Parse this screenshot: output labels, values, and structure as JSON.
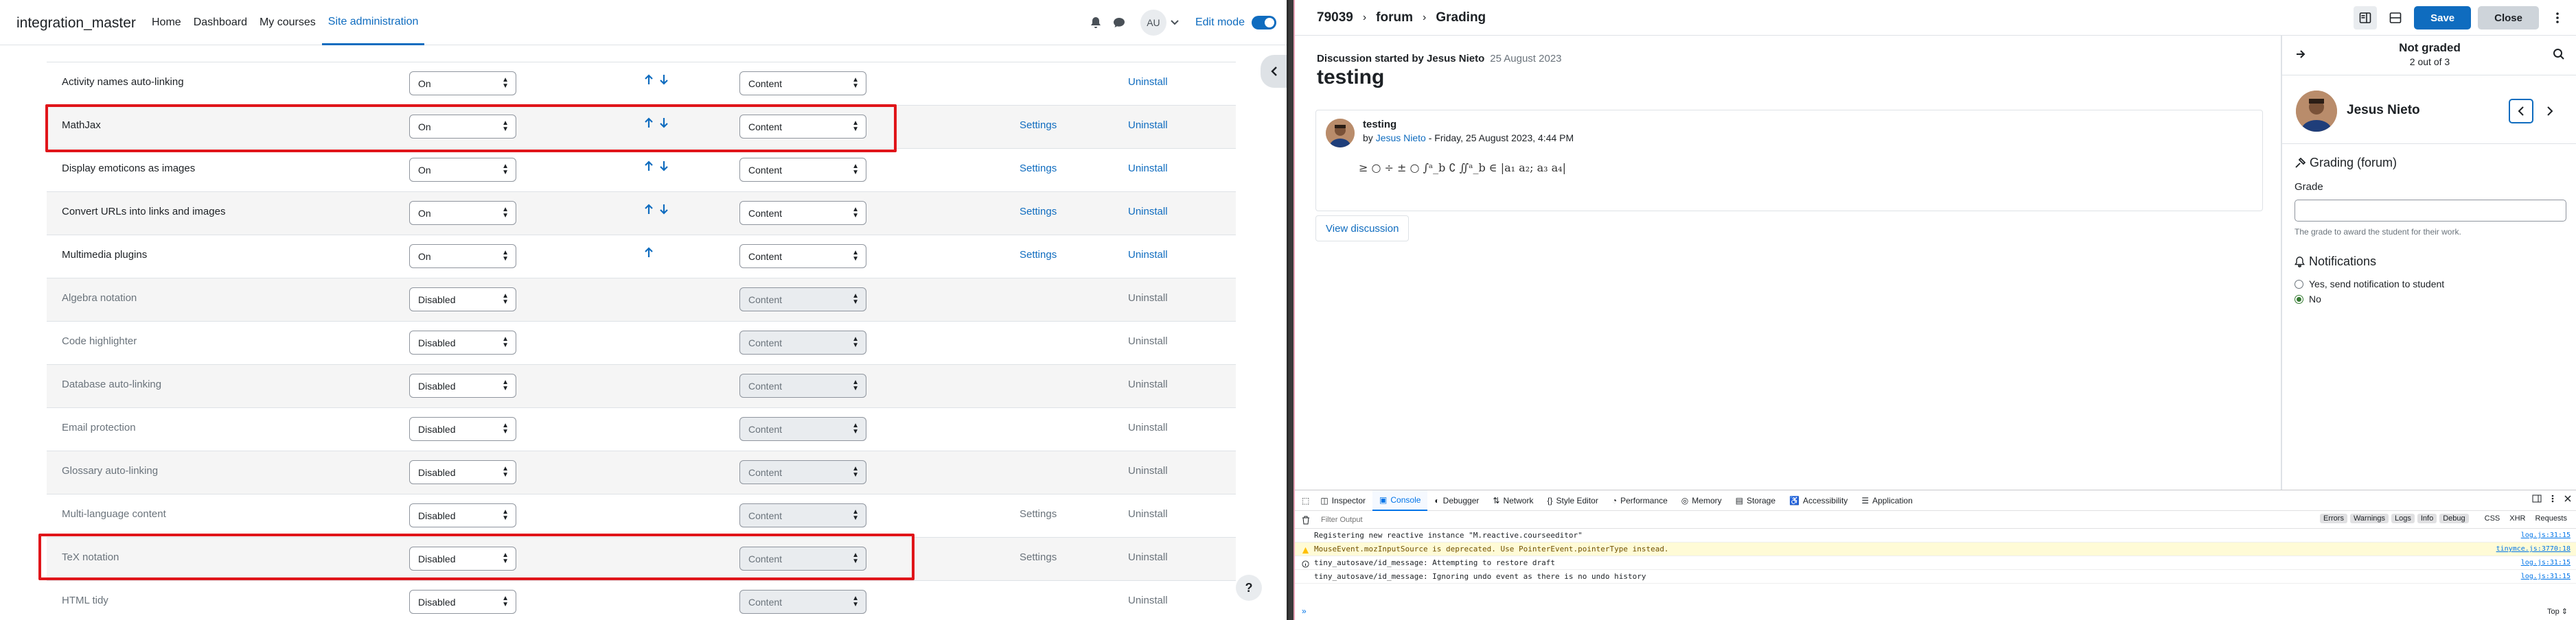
{
  "moodle": {
    "brand": "integration_master",
    "nav": [
      "Home",
      "Dashboard",
      "My courses",
      "Site administration"
    ],
    "avatar_initials": "AU",
    "edit_mode_label": "Edit mode",
    "settings_label": "Settings",
    "uninstall_label": "Uninstall",
    "help_label": "?",
    "filters": [
      {
        "name": "Activity names auto-linking",
        "active": "On",
        "applyto": "Content",
        "up": true,
        "down": true,
        "settings": false,
        "disabled": false
      },
      {
        "name": "MathJax",
        "active": "On",
        "applyto": "Content",
        "up": true,
        "down": true,
        "settings": true,
        "disabled": false
      },
      {
        "name": "Display emoticons as images",
        "active": "On",
        "applyto": "Content",
        "up": true,
        "down": true,
        "settings": true,
        "disabled": false
      },
      {
        "name": "Convert URLs into links and images",
        "active": "On",
        "applyto": "Content",
        "up": true,
        "down": true,
        "settings": true,
        "disabled": false
      },
      {
        "name": "Multimedia plugins",
        "active": "On",
        "applyto": "Content",
        "up": true,
        "down": false,
        "settings": true,
        "disabled": false
      },
      {
        "name": "Algebra notation",
        "active": "Disabled",
        "applyto": "Content",
        "up": false,
        "down": false,
        "settings": false,
        "disabled": true
      },
      {
        "name": "Code highlighter",
        "active": "Disabled",
        "applyto": "Content",
        "up": false,
        "down": false,
        "settings": false,
        "disabled": true
      },
      {
        "name": "Database auto-linking",
        "active": "Disabled",
        "applyto": "Content",
        "up": false,
        "down": false,
        "settings": false,
        "disabled": true
      },
      {
        "name": "Email protection",
        "active": "Disabled",
        "applyto": "Content",
        "up": false,
        "down": false,
        "settings": false,
        "disabled": true
      },
      {
        "name": "Glossary auto-linking",
        "active": "Disabled",
        "applyto": "Content",
        "up": false,
        "down": false,
        "settings": false,
        "disabled": true
      },
      {
        "name": "Multi-language content",
        "active": "Disabled",
        "applyto": "Content",
        "up": false,
        "down": false,
        "settings": true,
        "disabled": true
      },
      {
        "name": "TeX notation",
        "active": "Disabled",
        "applyto": "Content",
        "up": false,
        "down": false,
        "settings": true,
        "disabled": true
      },
      {
        "name": "HTML tidy",
        "active": "Disabled",
        "applyto": "Content",
        "up": false,
        "down": false,
        "settings": false,
        "disabled": true
      }
    ]
  },
  "grading": {
    "breadcrumb": [
      "79039",
      "forum",
      "Grading"
    ],
    "save_label": "Save",
    "close_label": "Close",
    "discussion_started_by": "Discussion started by Jesus Nieto",
    "discussion_date": "25 August 2023",
    "discussion_title": "testing",
    "post_title": "testing",
    "post_by_prefix": "by",
    "post_author": "Jesus Nieto",
    "post_date": "- Friday, 25 August 2023, 4:44 PM",
    "post_math": "≥ ○ ÷ ± ○ ∫ᵃ_b ∁ ∬ᵃ_b ∈ |a₁ a₂; a₃ a₄|",
    "view_discussion": "View discussion",
    "status": "Not graded",
    "count": "2 out of 3",
    "user_name": "Jesus Nieto",
    "grading_title": "Grading (forum)",
    "grade_label": "Grade",
    "grade_value": "",
    "grade_help": "The grade to award the student for their work.",
    "notifications_title": "Notifications",
    "notify_yes": "Yes, send notification to student",
    "notify_no": "No",
    "notify_selected": "no"
  },
  "devtools": {
    "tabs": [
      "Inspector",
      "Console",
      "Debugger",
      "Network",
      "Style Editor",
      "Performance",
      "Memory",
      "Storage",
      "Accessibility",
      "Application"
    ],
    "active_tab": "Console",
    "filter_placeholder": "Filter Output",
    "levels": [
      "Errors",
      "Warnings",
      "Logs",
      "Info",
      "Debug"
    ],
    "extras": [
      "CSS",
      "XHR",
      "Requests"
    ],
    "logs": [
      {
        "type": "log",
        "text": "Registering new reactive instance \"M.reactive.courseeditor\"",
        "src": "log.js:31:15"
      },
      {
        "type": "warn",
        "text": "MouseEvent.mozInputSource is deprecated. Use PointerEvent.pointerType instead.",
        "src": "tinymce.js:3770:18"
      },
      {
        "type": "info",
        "text": "tiny_autosave/id_message: Attempting to restore draft",
        "src": "log.js:31:15"
      },
      {
        "type": "log",
        "text": "tiny_autosave/id_message: Ignoring undo event as there is no undo history",
        "src": "log.js:31:15"
      }
    ],
    "prompt": "»",
    "top_label": "Top ⇕"
  },
  "colors": {
    "accent": "#0f6cbf",
    "highlight": "#e0151a",
    "success": "#357a32"
  }
}
